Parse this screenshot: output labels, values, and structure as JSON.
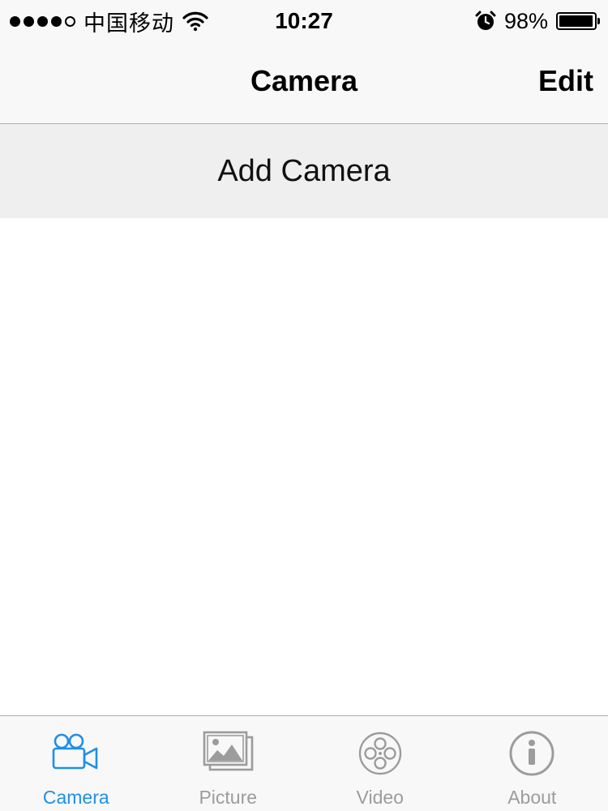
{
  "status_bar": {
    "carrier": "中国移动",
    "time": "10:27",
    "battery_percent": "98%",
    "battery_level": 0.98,
    "signal_bars_filled": 4,
    "signal_bars_total": 5,
    "icons": [
      "wifi-icon",
      "alarm-icon",
      "battery-icon"
    ]
  },
  "nav": {
    "title": "Camera",
    "edit_label": "Edit"
  },
  "list": {
    "add_camera_label": "Add Camera"
  },
  "tabs": [
    {
      "label": "Camera",
      "icon": "video-camera-icon",
      "active": true
    },
    {
      "label": "Picture",
      "icon": "picture-icon",
      "active": false
    },
    {
      "label": "Video",
      "icon": "film-reel-icon",
      "active": false
    },
    {
      "label": "About",
      "icon": "info-icon",
      "active": false
    }
  ],
  "colors": {
    "active_tab": "#1f8fe6",
    "inactive_tab": "#9c9c9c",
    "bar_background": "#f8f8f9",
    "row_background": "#efeff0"
  }
}
